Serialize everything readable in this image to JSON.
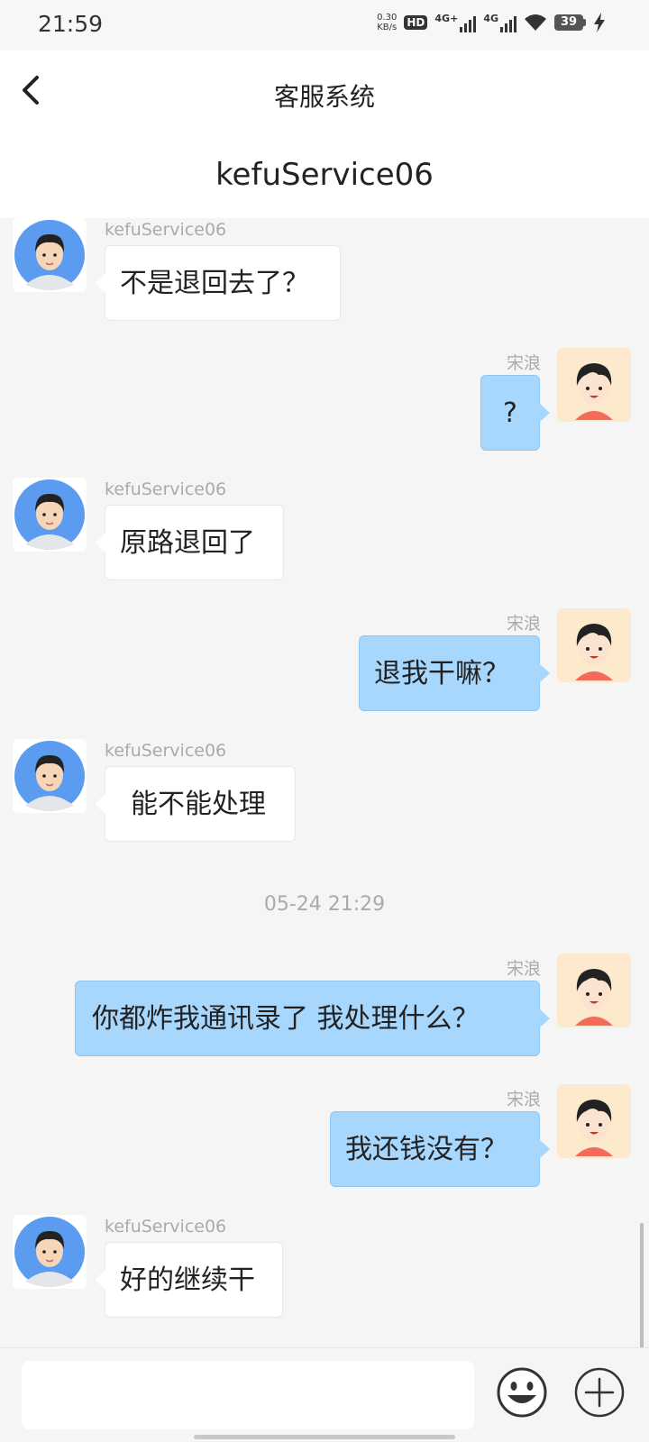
{
  "status_bar": {
    "time": "21:59",
    "net_speed_value": "0.30",
    "net_speed_unit": "KB/s",
    "hd": "HD",
    "sim1_type": "4G+",
    "sim2_type": "4G",
    "battery": "39"
  },
  "header": {
    "back_icon": "chevron-left-icon",
    "title": "客服系统",
    "subtitle": "kefuService06"
  },
  "colors": {
    "header_bg": "#ffffff",
    "chat_bg": "#f5f5f5",
    "incoming_bubble": "#ffffff",
    "outgoing_bubble": "#a8d7fe",
    "agent_avatar_bg": "#5b9cf0",
    "user_avatar_bg": "#fde9cc"
  },
  "messages": [
    {
      "side": "left",
      "sender": "kefuService06",
      "text": "不是退回去了？"
    },
    {
      "side": "right",
      "sender": "宋浪",
      "text": "?"
    },
    {
      "side": "left",
      "sender": "kefuService06",
      "text": "原路退回了"
    },
    {
      "side": "right",
      "sender": "宋浪",
      "text": "退我干嘛？"
    },
    {
      "side": "left",
      "sender": "kefuService06",
      "text": "能不能处理"
    },
    {
      "side": "right",
      "sender": "宋浪",
      "text": "你都炸我通讯录了 我处理什么？"
    },
    {
      "side": "right",
      "sender": "宋浪",
      "text": "我还钱没有？"
    },
    {
      "side": "left",
      "sender": "kefuService06",
      "text": "好的继续干"
    }
  ],
  "timestamp": "05-24 21:29",
  "input_bar": {
    "input_value": "",
    "placeholder": "",
    "emoji_icon": "smiley-face-icon",
    "plus_icon": "plus-circle-icon"
  }
}
